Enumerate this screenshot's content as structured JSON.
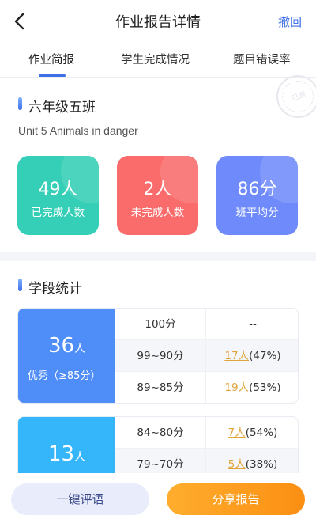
{
  "header": {
    "title": "作业报告详情",
    "revoke_label": "撤回"
  },
  "tabs": [
    {
      "label": "作业简报",
      "active": true
    },
    {
      "label": "学生完成情况",
      "active": false
    },
    {
      "label": "题目错误率",
      "active": false
    }
  ],
  "stamp": {
    "text": "已测"
  },
  "summary": {
    "class_name": "六年级五班",
    "unit": "Unit 5 Animals in danger",
    "stats": [
      {
        "value": "49人",
        "label": "已完成人数",
        "color": "#34cfb6"
      },
      {
        "value": "2人",
        "label": "未完成人数",
        "color": "#fa6b6b"
      },
      {
        "value": "86分",
        "label": "班平均分",
        "color": "#6f8bfb"
      }
    ]
  },
  "segments": {
    "title": "学段统计",
    "groups": [
      {
        "count": "36",
        "unit": "人",
        "label": "优秀（≥85分）",
        "color": "#4f8df8",
        "rows": [
          {
            "range": "100分",
            "value": "--"
          },
          {
            "range": "99~90分",
            "count": "17人",
            "pct": "(47%)"
          },
          {
            "range": "89~85分",
            "count": "19人",
            "pct": "(53%)"
          }
        ]
      },
      {
        "count": "13",
        "unit": "人",
        "label": "",
        "color": "#35b6fb",
        "rows": [
          {
            "range": "84~80分",
            "count": "7人",
            "pct": "(54%)"
          },
          {
            "range": "79~70分",
            "count": "5人",
            "pct": "(38%)"
          }
        ]
      }
    ]
  },
  "actions": {
    "comment_label": "一键评语",
    "share_label": "分享报告"
  }
}
